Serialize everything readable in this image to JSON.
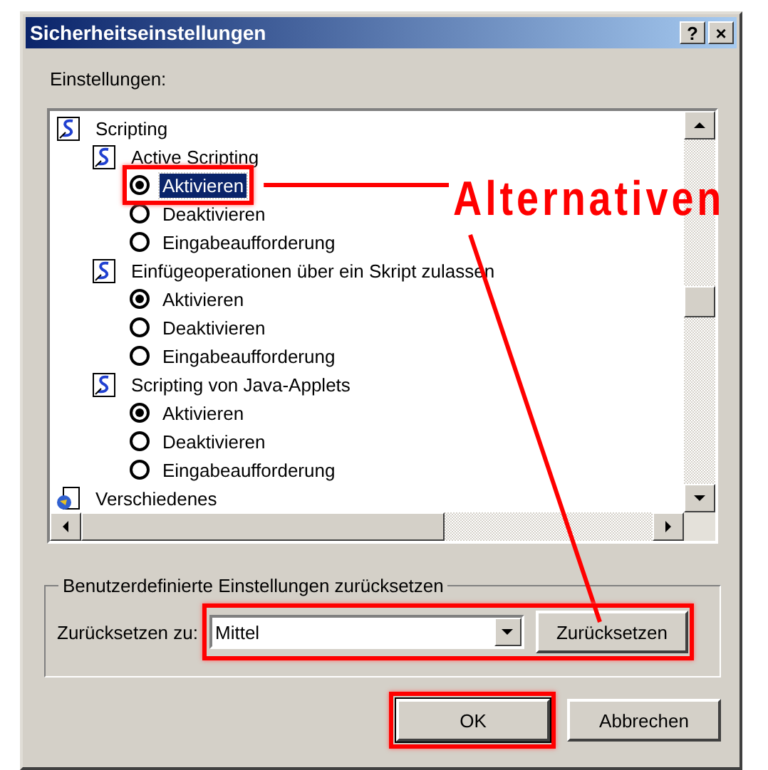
{
  "window": {
    "title": "Sicherheitseinstellungen",
    "buttons": [
      {
        "label": "?"
      },
      {
        "label": "×"
      }
    ]
  },
  "settings_label": "Einstellungen:",
  "tree": [
    {
      "kind": "group",
      "label": "Scripting",
      "children": [
        {
          "kind": "setting",
          "label": "Active Scripting",
          "children": [
            {
              "kind": "option",
              "label": "Aktivieren",
              "selected": true,
              "focused": true,
              "annotated": true
            },
            {
              "kind": "option",
              "label": "Deaktivieren",
              "selected": false,
              "focused": false,
              "annotated": false
            },
            {
              "kind": "option",
              "label": "Eingabeaufforderung",
              "selected": false,
              "focused": false,
              "annotated": false
            }
          ]
        },
        {
          "kind": "setting",
          "label": "Einfügeoperationen über ein Skript zulassen",
          "children": [
            {
              "kind": "option",
              "label": "Aktivieren",
              "selected": true,
              "focused": false,
              "annotated": false
            },
            {
              "kind": "option",
              "label": "Deaktivieren",
              "selected": false,
              "focused": false,
              "annotated": false
            },
            {
              "kind": "option",
              "label": "Eingabeaufforderung",
              "selected": false,
              "focused": false,
              "annotated": false
            }
          ]
        },
        {
          "kind": "setting",
          "label": "Scripting von Java-Applets",
          "children": [
            {
              "kind": "option",
              "label": "Aktivieren",
              "selected": true,
              "focused": false,
              "annotated": false
            },
            {
              "kind": "option",
              "label": "Deaktivieren",
              "selected": false,
              "focused": false,
              "annotated": false
            },
            {
              "kind": "option",
              "label": "Eingabeaufforderung",
              "selected": false,
              "focused": false,
              "annotated": false
            }
          ]
        }
      ]
    },
    {
      "kind": "misc-group",
      "label": "Verschiedenes"
    }
  ],
  "reset_group": {
    "title": "Benutzerdefinierte Einstellungen zurücksetzen",
    "label": "Zurücksetzen zu:",
    "value": "Mittel",
    "button": "Zurücksetzen",
    "annotated": true
  },
  "buttons": [
    {
      "label": "OK",
      "annotated": true
    },
    {
      "label": "Abbrechen",
      "annotated": false
    }
  ],
  "annotation": {
    "label": "Alternativen"
  }
}
